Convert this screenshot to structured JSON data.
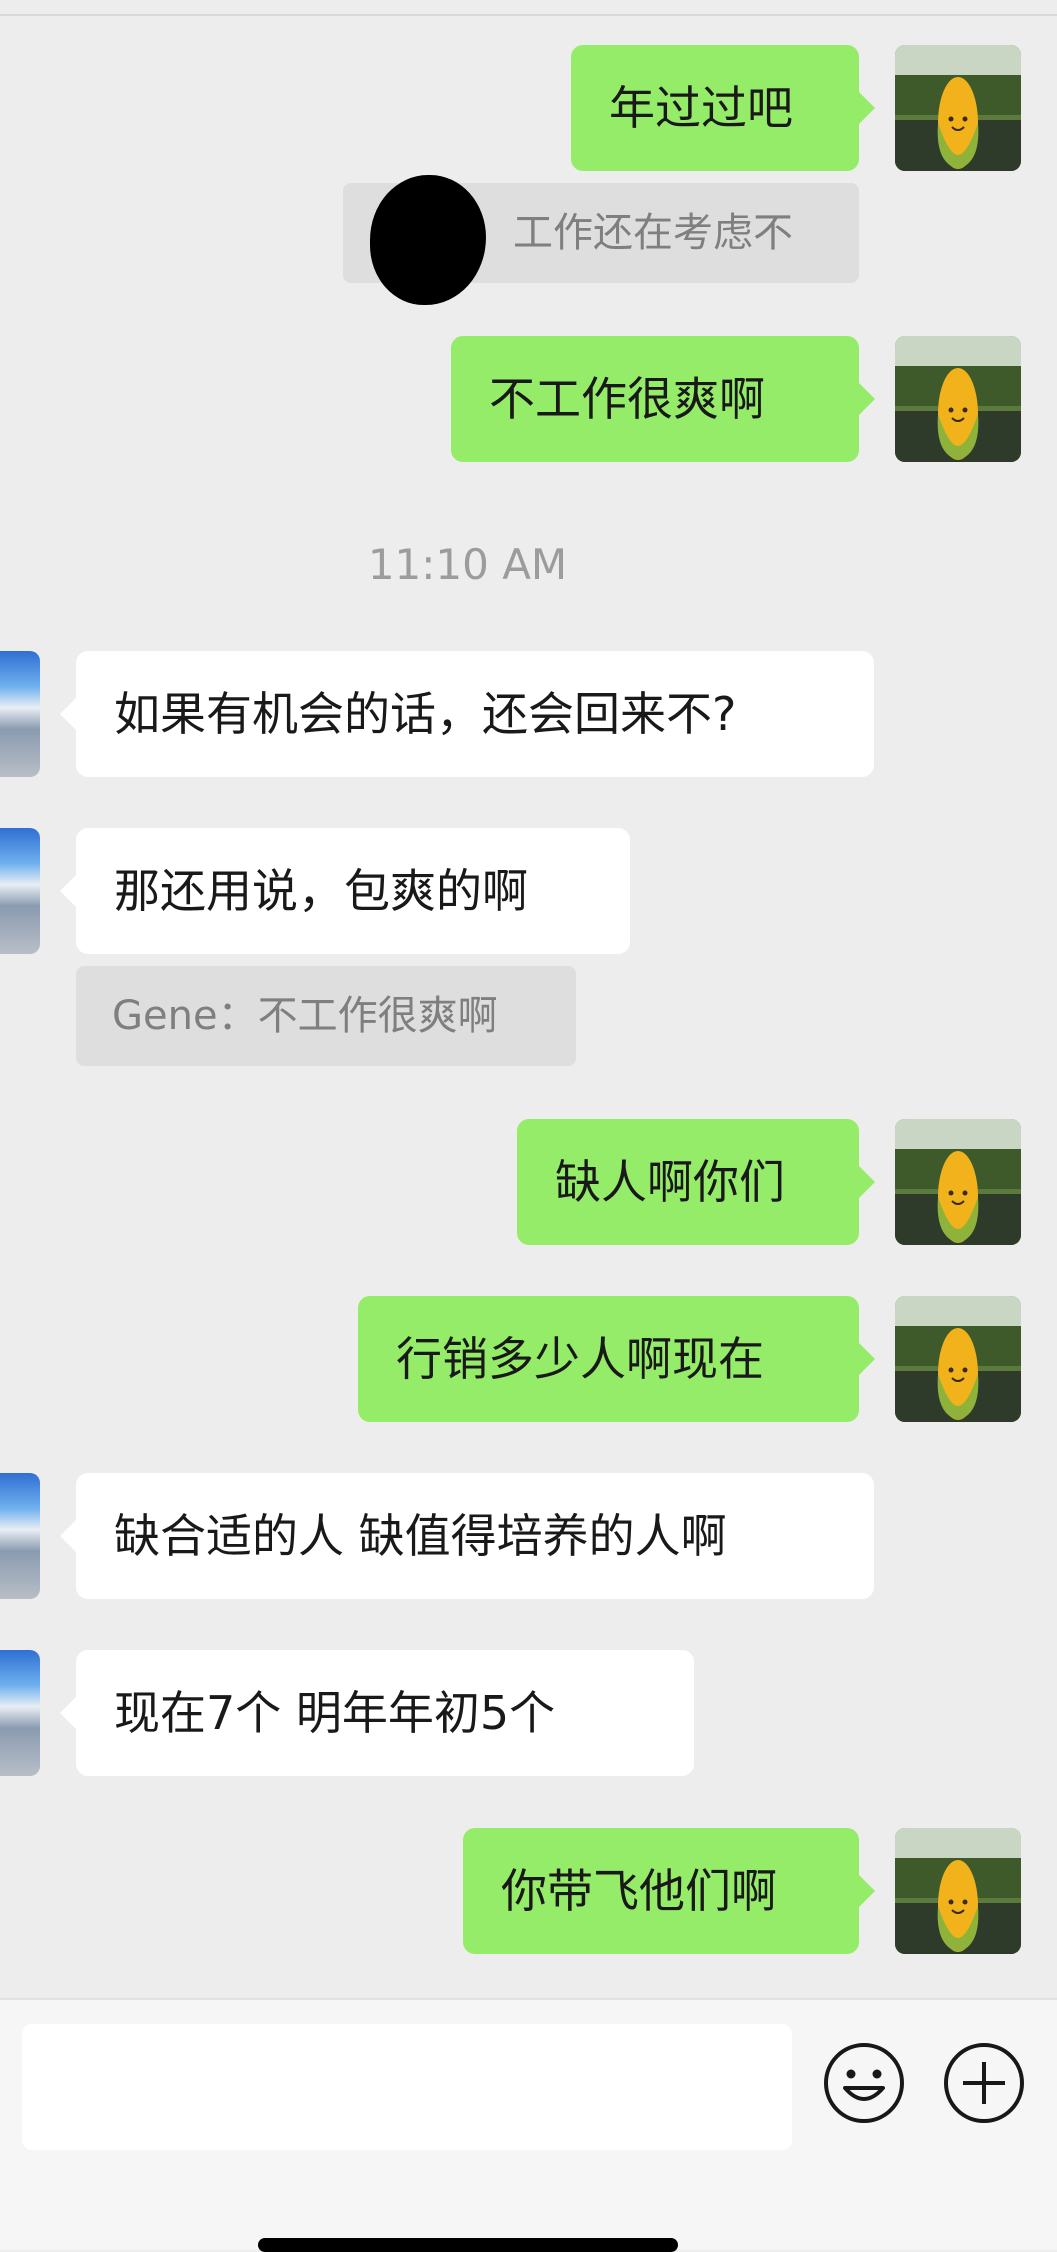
{
  "chat": {
    "messages": [
      {
        "text": "年过过吧"
      },
      {
        "quote": "工作还在考虑不"
      },
      {
        "text": "不工作很爽啊"
      },
      {
        "timestamp": "11:10 AM"
      },
      {
        "text": "如果有机会的话，还会回来不?"
      },
      {
        "text": "那还用说，包爽的啊"
      },
      {
        "quote": "Gene：不工作很爽啊"
      },
      {
        "text": "缺人啊你们"
      },
      {
        "text": "行销多少人啊现在"
      },
      {
        "text": "缺合适的人  缺值得培养的人啊"
      },
      {
        "text": "现在7个  明年年初5个"
      },
      {
        "text": "你带飞他们啊"
      }
    ]
  },
  "input_bar": {
    "input_value": "",
    "emoji_icon": "emoji-icon",
    "plus_icon": "plus-circle-icon"
  },
  "colors": {
    "background": "#ededed",
    "self_bubble": "#95ec69",
    "other_bubble": "#ffffff",
    "quote_bg": "#dedede"
  }
}
